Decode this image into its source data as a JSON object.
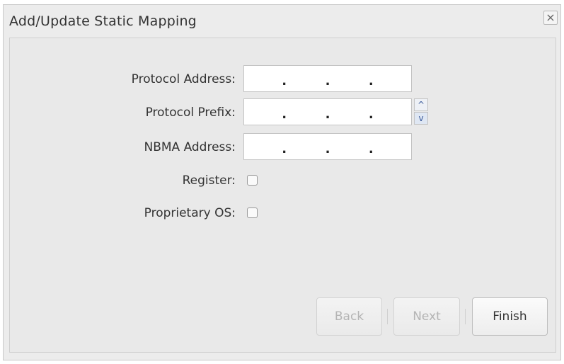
{
  "dialog": {
    "title": "Add/Update Static Mapping",
    "close_label": "×"
  },
  "form": {
    "protocol_address_label": "Protocol Address:",
    "protocol_prefix_label": "Protocol Prefix:",
    "nbma_address_label": "NBMA Address:",
    "register_label": "Register:",
    "proprietary_os_label": "Proprietary OS:",
    "dot": ".",
    "register_checked": false,
    "proprietary_os_checked": false
  },
  "buttons": {
    "back_label": "Back",
    "next_label": "Next",
    "finish_label": "Finish"
  },
  "icons": {
    "spin_up": "^",
    "spin_down": "v"
  }
}
